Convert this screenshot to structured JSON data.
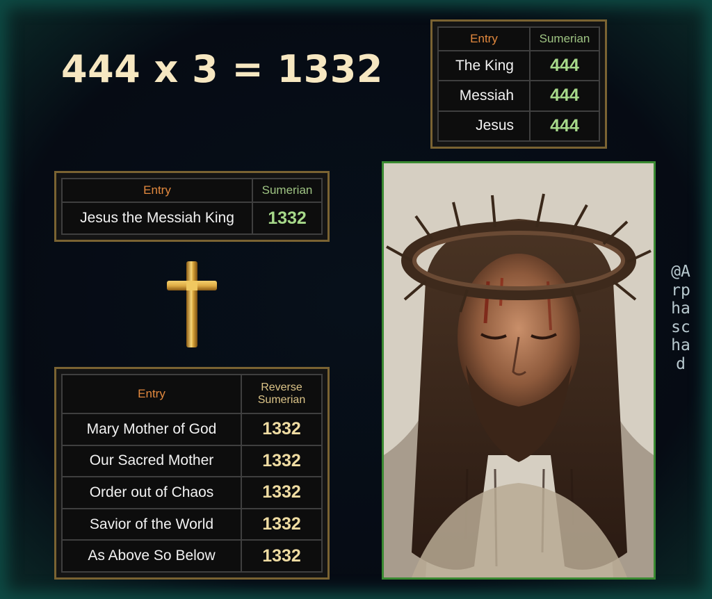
{
  "headline": "444 x 3 = 1332",
  "table_top": {
    "header_entry": "Entry",
    "header_value": "Sumerian",
    "rows": [
      {
        "entry": "The King",
        "value": "444"
      },
      {
        "entry": "Messiah",
        "value": "444"
      },
      {
        "entry": "Jesus",
        "value": "444"
      }
    ]
  },
  "table_mid": {
    "header_entry": "Entry",
    "header_value": "Sumerian",
    "rows": [
      {
        "entry": "Jesus the Messiah King",
        "value": "1332"
      }
    ]
  },
  "table_bottom": {
    "header_entry": "Entry",
    "header_value_line1": "Reverse",
    "header_value_line2": "Sumerian",
    "rows": [
      {
        "entry": "Mary Mother of God",
        "value": "1332"
      },
      {
        "entry": "Our Sacred Mother",
        "value": "1332"
      },
      {
        "entry": "Order out of Chaos",
        "value": "1332"
      },
      {
        "entry": "Savior of the World",
        "value": "1332"
      },
      {
        "entry": "As Above So Below",
        "value": "1332"
      }
    ]
  },
  "handle": "@Arphaschad",
  "icons": {
    "cross": "cross-icon",
    "portrait": "crown-of-thorns-portrait"
  },
  "colors": {
    "background": "#060b14",
    "glow": "#0e4a44",
    "headline": "#f6e7c1",
    "table_border": "#7a6332",
    "header_entry": "#e3893e",
    "header_sumerian": "#9fc483",
    "value_green": "#a7d98a",
    "value_gold": "#efdca2",
    "portrait_border": "#3a8a32"
  }
}
